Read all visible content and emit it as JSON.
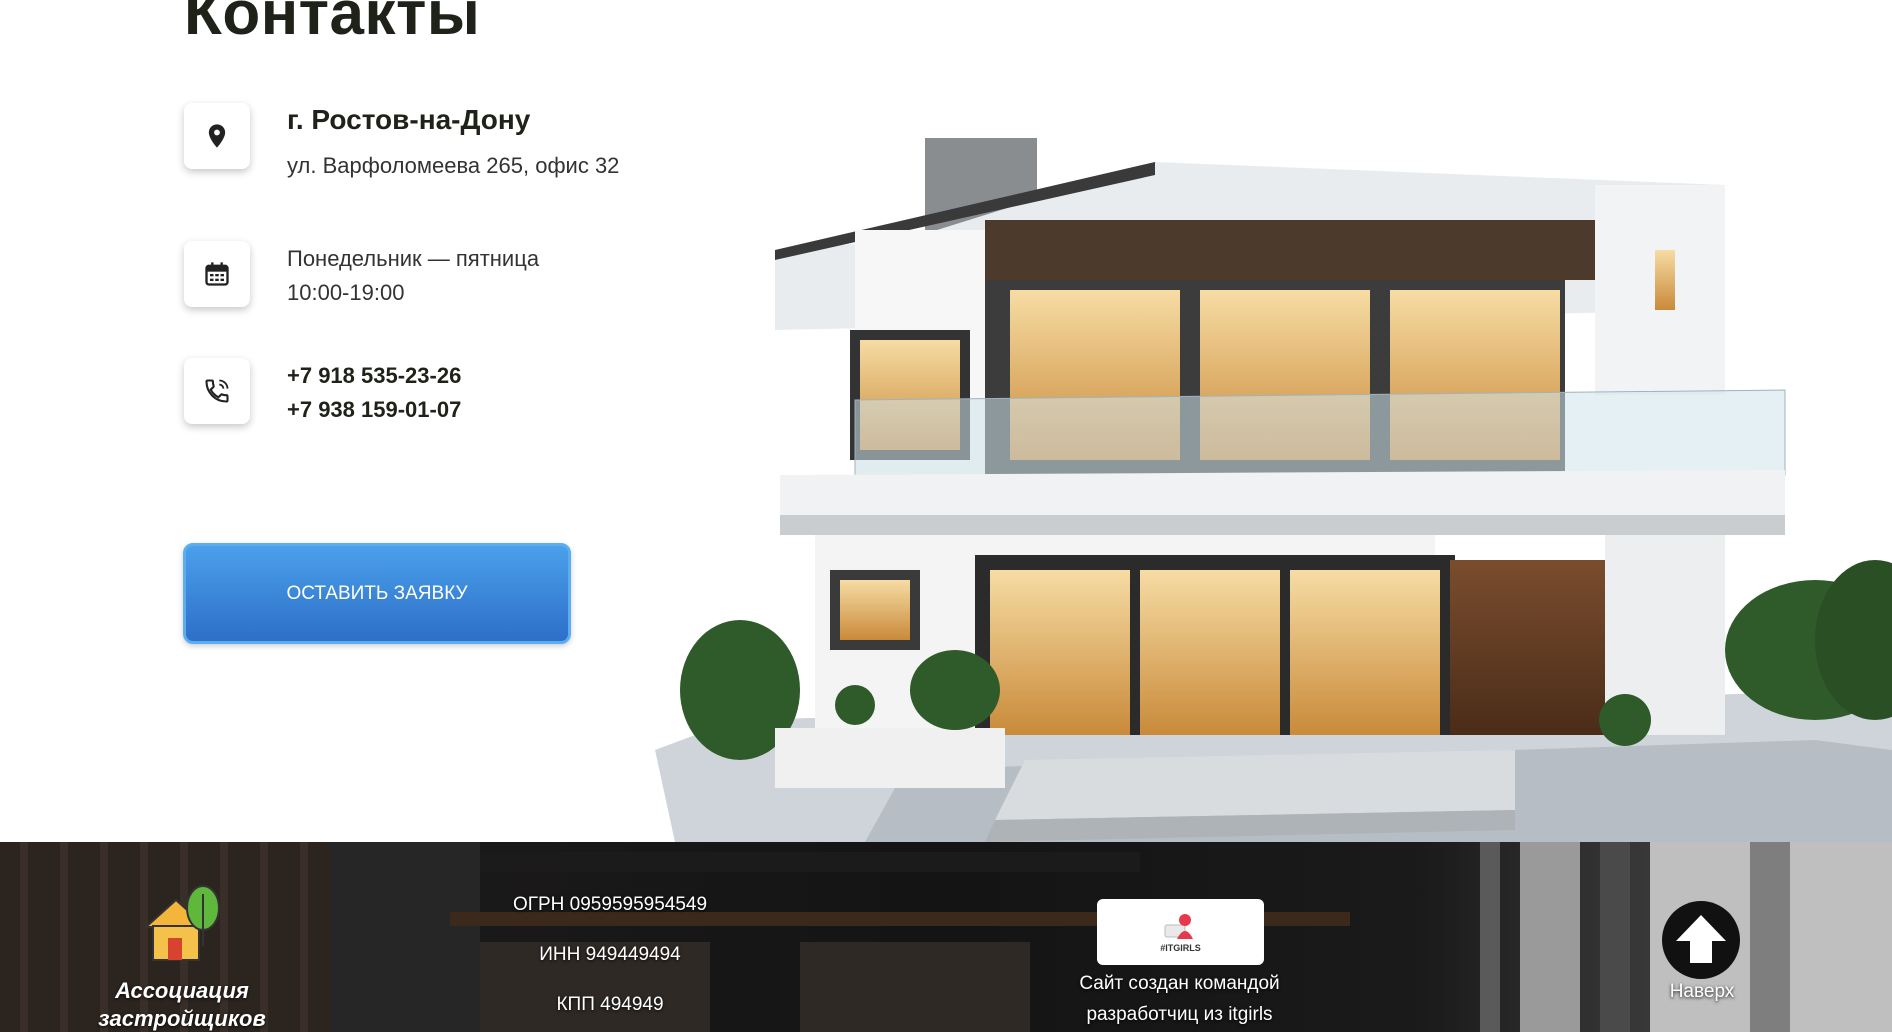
{
  "page": {
    "title": "Контакты"
  },
  "contacts": {
    "address": {
      "icon": "map-pin-icon",
      "city": "г. Ростов-на-Дону",
      "street": "ул. Варфоломеева 265, офис 32"
    },
    "schedule": {
      "icon": "calendar-icon",
      "days": "Понедельник — пятница",
      "time": "10:00-19:00"
    },
    "phones": {
      "icon": "phone-icon",
      "phone1": "+7 918 535-23-26",
      "phone2": "+7 938 159-01-07"
    }
  },
  "cta": {
    "label": "ОСТАВИТЬ ЗАЯВКУ",
    "color": "#3a86dc"
  },
  "footer": {
    "association": {
      "name_line1": "Ассоциация",
      "name_line2": "застройщиков",
      "icon": "house-tree-logo"
    },
    "registration": {
      "ogrn": "ОГРН 0959595954549",
      "inn": "ИНН 949449494",
      "kpp": "КПП 494949"
    },
    "credits": {
      "badge": "#ITGIRLS",
      "line1": "Сайт создан командой",
      "line2": "разработчиц из itgirls"
    },
    "to_top": {
      "label": "Наверх",
      "icon": "arrow-up-icon"
    }
  }
}
